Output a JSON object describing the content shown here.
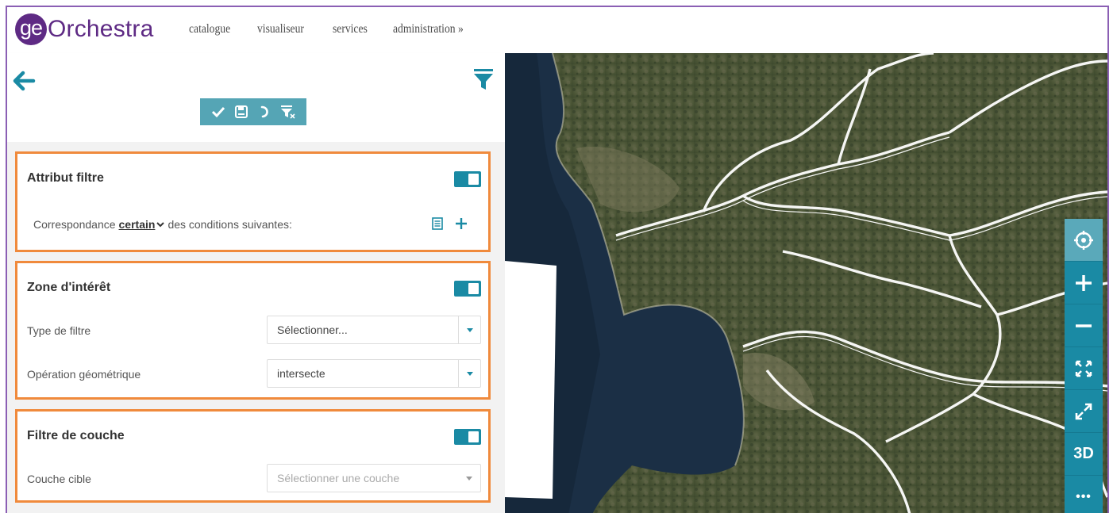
{
  "app": {
    "logo_prefix": "ge",
    "logo_name": "Orchestra"
  },
  "nav": [
    {
      "label": "catalogue"
    },
    {
      "label": "visualiseur"
    },
    {
      "label": "services"
    },
    {
      "label": "administration »"
    }
  ],
  "toolbar": {
    "icons": [
      "check-icon",
      "save-icon",
      "undo-icon",
      "clear-filter-icon"
    ]
  },
  "cards": {
    "attribut": {
      "title": "Attribut filtre",
      "match_prefix": "Correspondance",
      "match_value": "certain",
      "match_suffix": "des conditions suivantes:"
    },
    "zone": {
      "title": "Zone d'intérêt",
      "type_label": "Type de filtre",
      "type_value": "Sélectionner...",
      "operation_label": "Opération géométrique",
      "operation_value": "intersecte"
    },
    "couche": {
      "title": "Filtre de couche",
      "target_label": "Couche cible",
      "target_placeholder": "Sélectionner une couche"
    }
  },
  "map_controls": {
    "three_d": "3D",
    "more": "•••"
  },
  "colors": {
    "brand": "#5e2a84",
    "accent": "#1a8aa4",
    "highlight_border": "#f08a3c",
    "frame": "#8b5fb4"
  }
}
